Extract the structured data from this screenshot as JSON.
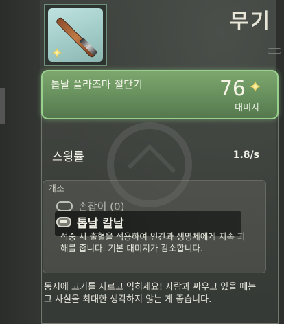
{
  "category": "무기",
  "item": {
    "name": "톱날 플라즈마 절단기",
    "stat_value": "76",
    "stat_label": "대미지",
    "icon_name": "plasma-cutter-weapon-icon"
  },
  "stats": {
    "swing_rate_label": "스윙률",
    "swing_rate_value": "1.8/s"
  },
  "modifications": {
    "title": "개조",
    "slot1_label": "손잡이 (0)",
    "slot2_label": "톱날 칼날",
    "slot2_description": "적중 시 출혈을 적용하여 인간과 생명체에게 지속 피해를 줍니다. 기본 대미지가 감소합니다."
  },
  "flavor_text": "동시에 고기를 자르고 익히세요! 사람과 싸우고 있을 때는 그 사실을 최대한 생각하지 않는 게 좋습니다.",
  "colors": {
    "header_green": "#6a9360",
    "header_border": "#9ad08e",
    "background": "#3a3d3a"
  }
}
